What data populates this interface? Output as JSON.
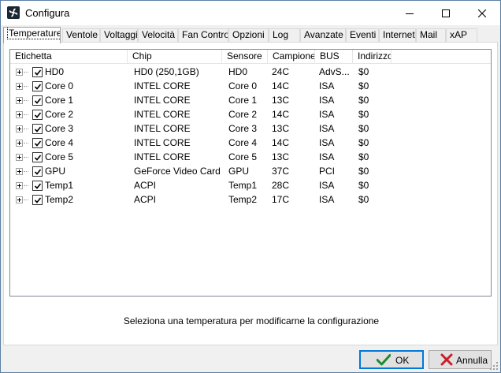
{
  "window": {
    "title": "Configura",
    "icon": "fan-app-icon",
    "controls": [
      "minimize-icon",
      "maximize-icon",
      "close-icon"
    ]
  },
  "tabs": [
    {
      "label": "Temperature",
      "active": true
    },
    {
      "label": "Ventole",
      "active": false
    },
    {
      "label": "Voltaggi",
      "active": false
    },
    {
      "label": "Velocità",
      "active": false
    },
    {
      "label": "Fan Control",
      "active": false
    },
    {
      "label": "Opzioni",
      "active": false
    },
    {
      "label": "Log",
      "active": false
    },
    {
      "label": "Avanzate",
      "active": false
    },
    {
      "label": "Eventi",
      "active": false
    },
    {
      "label": "Internet",
      "active": false
    },
    {
      "label": "Mail",
      "active": false
    },
    {
      "label": "xAP",
      "active": false
    }
  ],
  "table": {
    "columns": [
      "Etichetta",
      "Chip",
      "Sensore",
      "Campione",
      "BUS",
      "Indirizzo"
    ],
    "rows": [
      {
        "label": "HD0",
        "chip": "HD0 (250,1GB)",
        "sensor": "HD0",
        "sample": "24C",
        "bus": "AdvS...",
        "address": "$0",
        "checked": true
      },
      {
        "label": "Core 0",
        "chip": "INTEL CORE",
        "sensor": "Core 0",
        "sample": "14C",
        "bus": "ISA",
        "address": "$0",
        "checked": true
      },
      {
        "label": "Core 1",
        "chip": "INTEL CORE",
        "sensor": "Core 1",
        "sample": "13C",
        "bus": "ISA",
        "address": "$0",
        "checked": true
      },
      {
        "label": "Core 2",
        "chip": "INTEL CORE",
        "sensor": "Core 2",
        "sample": "14C",
        "bus": "ISA",
        "address": "$0",
        "checked": true
      },
      {
        "label": "Core 3",
        "chip": "INTEL CORE",
        "sensor": "Core 3",
        "sample": "13C",
        "bus": "ISA",
        "address": "$0",
        "checked": true
      },
      {
        "label": "Core 4",
        "chip": "INTEL CORE",
        "sensor": "Core 4",
        "sample": "14C",
        "bus": "ISA",
        "address": "$0",
        "checked": true
      },
      {
        "label": "Core 5",
        "chip": "INTEL CORE",
        "sensor": "Core 5",
        "sample": "13C",
        "bus": "ISA",
        "address": "$0",
        "checked": true
      },
      {
        "label": "GPU",
        "chip": "GeForce Video Card",
        "sensor": "GPU",
        "sample": "37C",
        "bus": "PCI",
        "address": "$0",
        "checked": true
      },
      {
        "label": "Temp1",
        "chip": "ACPI",
        "sensor": "Temp1",
        "sample": "28C",
        "bus": "ISA",
        "address": "$0",
        "checked": true
      },
      {
        "label": "Temp2",
        "chip": "ACPI",
        "sensor": "Temp2",
        "sample": "17C",
        "bus": "ISA",
        "address": "$0",
        "checked": true
      }
    ]
  },
  "hint": "Seleziona una temperatura per modificarne la configurazione",
  "buttons": {
    "ok_label": "OK",
    "cancel_label": "Annulla",
    "ok_icon": "checkmark-icon",
    "cancel_icon": "x-icon"
  },
  "colors": {
    "accent": "#0078d7",
    "ok_icon": "#1e8a2e",
    "cancel_icon": "#c8202a"
  }
}
